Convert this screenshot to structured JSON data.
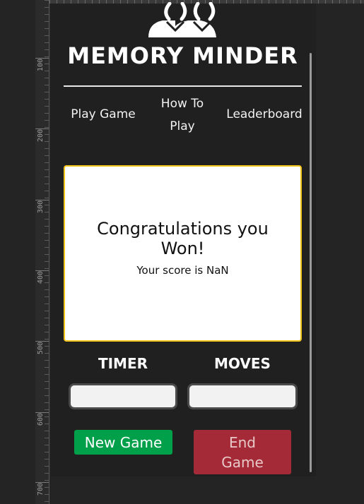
{
  "ruler": {
    "labels": [
      "100",
      "200",
      "300",
      "400",
      "500",
      "600",
      "700"
    ]
  },
  "app": {
    "title": "MEMORY MINDER"
  },
  "nav": {
    "play": "Play Game",
    "how_line1": "How To",
    "how_line2": "Play",
    "leaderboard": "Leaderboard"
  },
  "result": {
    "message": "Congratulations you Won!",
    "score": "Your score is NaN"
  },
  "stats": {
    "timer_label": "TIMER",
    "moves_label": "MOVES",
    "timer_value": "",
    "moves_value": ""
  },
  "buttons": {
    "new_game": "New Game",
    "end_line1": "End",
    "end_line2": "Game"
  },
  "colors": {
    "accent_border": "#f2c41a",
    "new_game": "#00a04a",
    "end_game": "#a32a36"
  }
}
